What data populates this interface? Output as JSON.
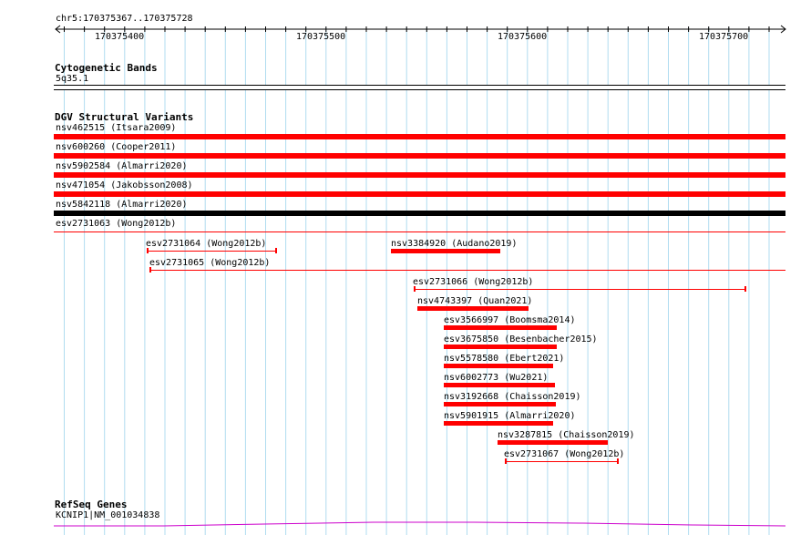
{
  "locus": "chr5:170375367..170375728",
  "ruler": {
    "ticks": [
      "170375400",
      "170375500",
      "170375600",
      "170375700"
    ]
  },
  "tracks": {
    "cytobands": {
      "title": "Cytogenetic Bands",
      "band": "5q35.1"
    },
    "dgv": {
      "title": "DGV Structural Variants",
      "features": [
        {
          "label": "nsv462515 (Itsara2009)",
          "style": "full-red"
        },
        {
          "label": "nsv600260 (Cooper2011)",
          "style": "full-red"
        },
        {
          "label": "nsv5902584 (Almarri2020)",
          "style": "full-red"
        },
        {
          "label": "nsv471054 (Jakobsson2008)",
          "style": "full-red"
        },
        {
          "label": "nsv5842118 (Almarri2020)",
          "style": "full-black"
        },
        {
          "label": "esv2731063 (Wong2012b)",
          "style": "full-thin"
        },
        {
          "label": "esv2731064 (Wong2012b)",
          "style": "range"
        },
        {
          "label": "nsv3384920 (Audano2019)",
          "style": "bar"
        },
        {
          "label": "esv2731065 (Wong2012b)",
          "style": "range-open"
        },
        {
          "label": "esv2731066 (Wong2012b)",
          "style": "range"
        },
        {
          "label": "nsv4743397 (Quan2021)",
          "style": "bar"
        },
        {
          "label": "esv3566997 (Boomsma2014)",
          "style": "bar"
        },
        {
          "label": "esv3675850 (Besenbacher2015)",
          "style": "bar"
        },
        {
          "label": "nsv5578580 (Ebert2021)",
          "style": "bar"
        },
        {
          "label": "nsv6002773 (Wu2021)",
          "style": "bar"
        },
        {
          "label": "nsv3192668 (Chaisson2019)",
          "style": "bar"
        },
        {
          "label": "nsv5901915 (Almarri2020)",
          "style": "bar"
        },
        {
          "label": "nsv3287815 (Chaisson2019)",
          "style": "bar"
        },
        {
          "label": "esv2731067 (Wong2012b)",
          "style": "range"
        }
      ]
    },
    "refseq": {
      "title": "RefSeq Genes",
      "gene": "KCNIP1|NM_001034838"
    }
  },
  "colors": {
    "variant": "#ff0000",
    "variant_alt": "#000000",
    "grid": "#b0dcf0",
    "gene": "#cc00cc"
  }
}
